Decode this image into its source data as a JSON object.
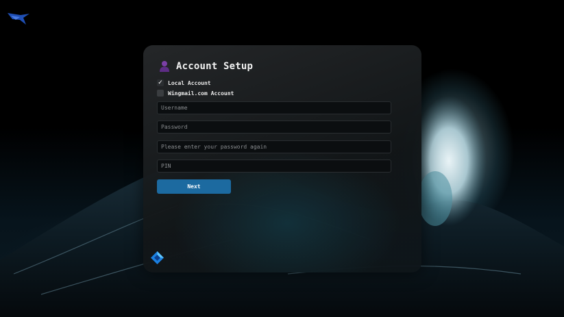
{
  "window": {
    "title": "Account Setup"
  },
  "account_types": [
    {
      "label": "Local Account",
      "checked": true
    },
    {
      "label": "Wingmail.com Account",
      "checked": false
    }
  ],
  "fields": {
    "username": {
      "placeholder": "Username",
      "value": ""
    },
    "password": {
      "placeholder": "Password",
      "value": ""
    },
    "password_confirm": {
      "placeholder": "Please enter your password again",
      "value": ""
    },
    "pin": {
      "placeholder": "PIN",
      "value": ""
    }
  },
  "actions": {
    "next_label": "Next"
  },
  "icons": {
    "title_icon": "user-silhouette-icon",
    "corner_logo": "bird-logo-icon",
    "brand_icon": "diamond-logo-icon"
  },
  "colors": {
    "accent": "#1c6aa0",
    "panel_background": "#1a1e21",
    "title_icon": "#7b3fa6"
  }
}
